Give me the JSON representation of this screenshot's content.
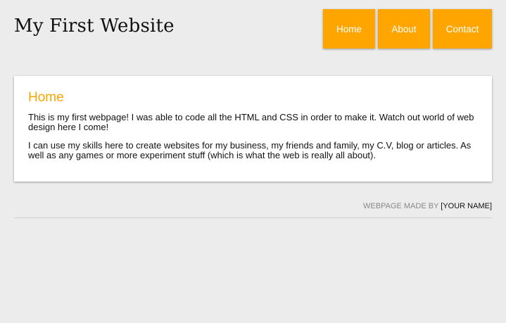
{
  "header": {
    "title": "My First Website",
    "nav": [
      {
        "label": "Home"
      },
      {
        "label": "About"
      },
      {
        "label": "Contact"
      }
    ]
  },
  "main": {
    "heading": "Home",
    "paragraphs": [
      "This is my first webpage! I was able to code all the HTML and CSS in order to make it. Watch out world of web design here I come!",
      "I can use my skills here to create websites for my business, my friends and family, my C.V, blog or articles. As well as any games or more experiment stuff (which is what the web is really all about)."
    ]
  },
  "footer": {
    "made_by": "WEBPAGE MADE BY",
    "name": "[YOUR NAME]"
  },
  "colors": {
    "accent": "#ffa500",
    "background": "#ececec"
  }
}
